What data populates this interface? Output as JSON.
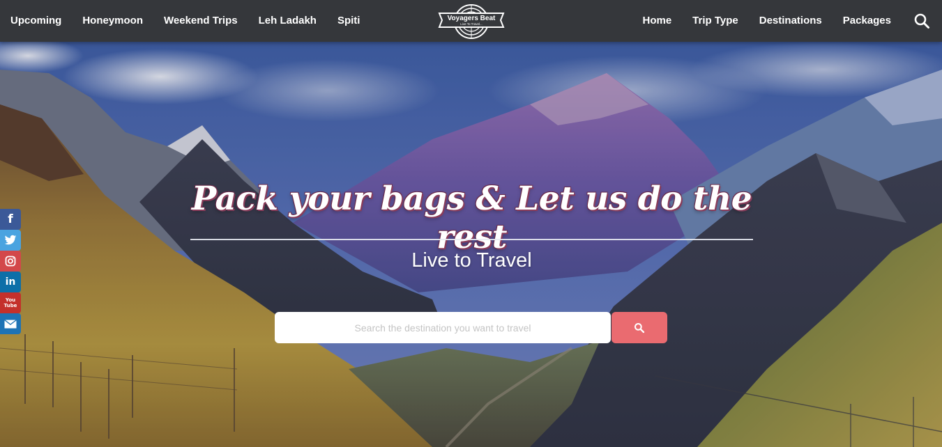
{
  "nav": {
    "left": [
      "Upcoming",
      "Honeymoon",
      "Weekend Trips",
      "Leh Ladakh",
      "Spiti"
    ],
    "right": [
      "Home",
      "Trip Type",
      "Destinations",
      "Packages"
    ],
    "search_icon": "search-icon"
  },
  "logo": {
    "name": "Voyagers Beat",
    "tagline": "Live To Travel..."
  },
  "hero": {
    "headline": "Pack your bags & Let us do the rest",
    "tagline": "Live to Travel",
    "search_placeholder": "Search the destination you want to travel",
    "search_button_icon": "search-icon"
  },
  "social": [
    "facebook-icon",
    "twitter-icon",
    "instagram-icon",
    "linkedin-icon",
    "youtube-icon",
    "mail-icon"
  ],
  "colors": {
    "navbar": "#35373b",
    "search_button": "#ea6b70"
  }
}
